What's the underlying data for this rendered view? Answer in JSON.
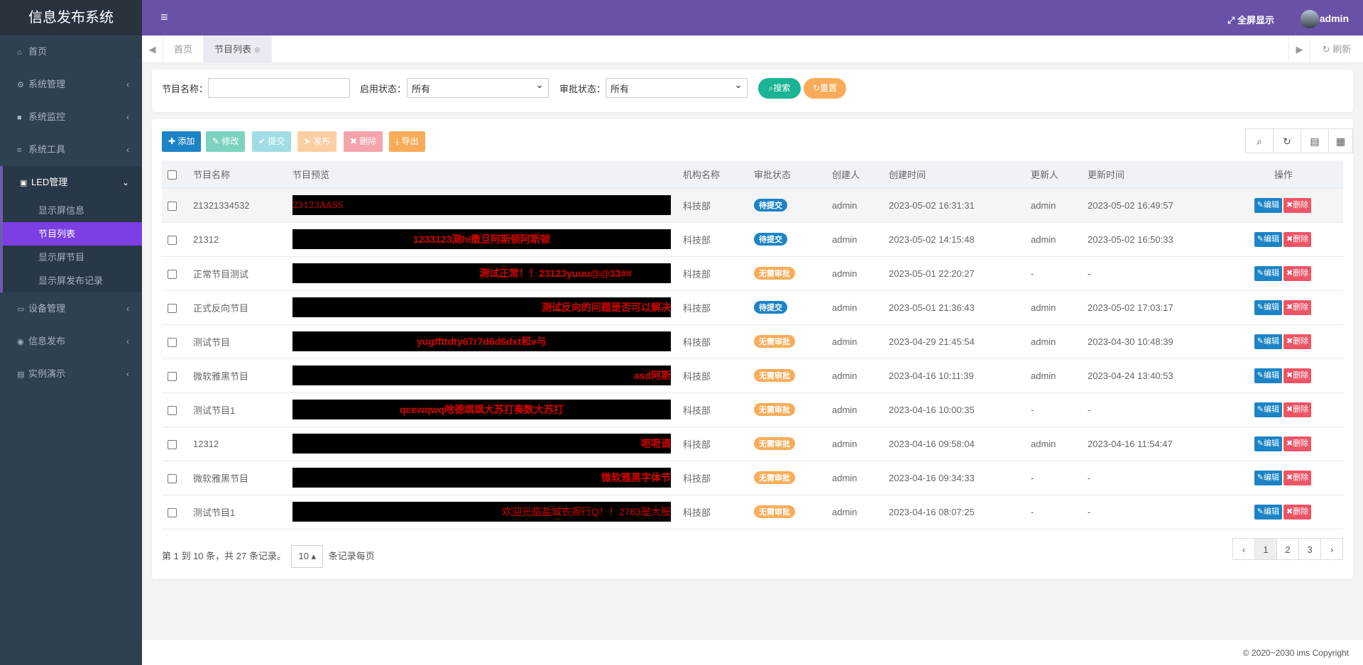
{
  "app": {
    "title": "信息发布系统"
  },
  "header": {
    "menu_icon": "hamburger-icon",
    "fullscreen_label": "全屏显示",
    "user_name": "admin"
  },
  "sidebar": {
    "items": [
      {
        "label": "首页",
        "icon": "home-icon"
      },
      {
        "label": "系统管理",
        "icon": "gear-icon"
      },
      {
        "label": "系统监控",
        "icon": "video-icon"
      },
      {
        "label": "系统工具",
        "icon": "bars-icon"
      },
      {
        "label": "LED管理",
        "icon": "led-icon"
      },
      {
        "label": "设备管理",
        "icon": "monitor-icon"
      },
      {
        "label": "信息发布",
        "icon": "circle-icon"
      },
      {
        "label": "实例演示",
        "icon": "book-icon"
      }
    ],
    "led_sub": [
      "显示屏信息",
      "节目列表",
      "显示屏节目",
      "显示屏发布记录"
    ]
  },
  "tabs": {
    "home": "首页",
    "current": "节目列表",
    "refresh": "刷新"
  },
  "search": {
    "name_label": "节目名称：",
    "name_value": "",
    "enable_label": "启用状态：",
    "enable_value": "所有",
    "approve_label": "审批状态：",
    "approve_value": "所有",
    "search_btn": "搜索",
    "reset_btn": "重置"
  },
  "toolbar": {
    "add": "添加",
    "edit": "修改",
    "submit": "提交",
    "publish": "发布",
    "delete": "删除",
    "export": "导出"
  },
  "table": {
    "headers": [
      "节目名称",
      "节目预览",
      "机构名称",
      "审批状态",
      "创建人",
      "创建时间",
      "更新人",
      "更新时间",
      "操作"
    ],
    "rows": [
      {
        "name": "21321334532",
        "preview": "23123AASS",
        "org": "科技部",
        "status": "待提交",
        "creator": "admin",
        "created": "2023-05-02 16:31:31",
        "updater": "admin",
        "updated": "2023-05-02 16:49:57"
      },
      {
        "name": "21312",
        "preview": "1233123测hi撒旦阿斯顿阿斯顿",
        "org": "科技部",
        "status": "待提交",
        "creator": "admin",
        "created": "2023-05-02 14:15:48",
        "updater": "admin",
        "updated": "2023-05-02 16:50:33"
      },
      {
        "name": "正常节目测试",
        "preview": "测试正常！！23123yuuu@@33##",
        "org": "科技部",
        "status": "无需审批",
        "creator": "admin",
        "created": "2023-05-01 22:20:27",
        "updater": "-",
        "updated": "-"
      },
      {
        "name": "正式反向节目",
        "preview": "测试反向的问题是否可以解决",
        "org": "科技部",
        "status": "待提交",
        "creator": "admin",
        "created": "2023-05-01 21:36:43",
        "updater": "admin",
        "updated": "2023-05-02 17:03:17"
      },
      {
        "name": "测试节目",
        "preview": "yugffttdty67r7d6d6dxt和v与",
        "org": "科技部",
        "status": "无需审批",
        "creator": "admin",
        "created": "2023-04-29 21:45:54",
        "updater": "admin",
        "updated": "2023-04-30 10:48:39"
      },
      {
        "name": "微软雅黑节目",
        "preview": "asd阿斯",
        "org": "科技部",
        "status": "无需审批",
        "creator": "admin",
        "created": "2023-04-16 10:11:39",
        "updater": "admin",
        "updated": "2023-04-24 13:40:53"
      },
      {
        "name": "测试节目1",
        "preview": "qeewqwq啥德飒飒大苏打奏数大苏打",
        "org": "科技部",
        "status": "无需审批",
        "creator": "admin",
        "created": "2023-04-16 10:00:35",
        "updater": "-",
        "updated": "-"
      },
      {
        "name": "12312",
        "preview": "呃呃请",
        "org": "科技部",
        "status": "无需审批",
        "creator": "admin",
        "created": "2023-04-16 09:58:04",
        "updater": "admin",
        "updated": "2023-04-16 11:54:47"
      },
      {
        "name": "微软雅黑节目",
        "preview": "微软雅黑字体节",
        "org": "科技部",
        "status": "无需审批",
        "creator": "admin",
        "created": "2023-04-16 09:34:33",
        "updater": "-",
        "updated": "-"
      },
      {
        "name": "测试节目1",
        "preview": "欢迎光临盐城衣阁行Q！！2783是大股",
        "org": "科技部",
        "status": "无需审批",
        "creator": "admin",
        "created": "2023-04-16 08:07:25",
        "updater": "-",
        "updated": "-"
      }
    ],
    "edit_label": "编辑",
    "delete_label": "删除"
  },
  "pagination": {
    "summary": "第 1 到 10 条，共 27 条记录。",
    "page_size": "10",
    "per_page_suffix": "条记录每页",
    "prev": "‹",
    "pages": [
      "1",
      "2",
      "3"
    ],
    "next": "›"
  },
  "footer": {
    "copyright": "© 2020~2030 ims Copyright"
  },
  "colors": {
    "header": "#6951a8",
    "sidebar": "#2f4050",
    "active": "#7b3fe4",
    "badge_pending": "#1c84c6",
    "badge_none": "#f8ac59",
    "edit": "#1c84c6",
    "delete": "#ed5565"
  }
}
